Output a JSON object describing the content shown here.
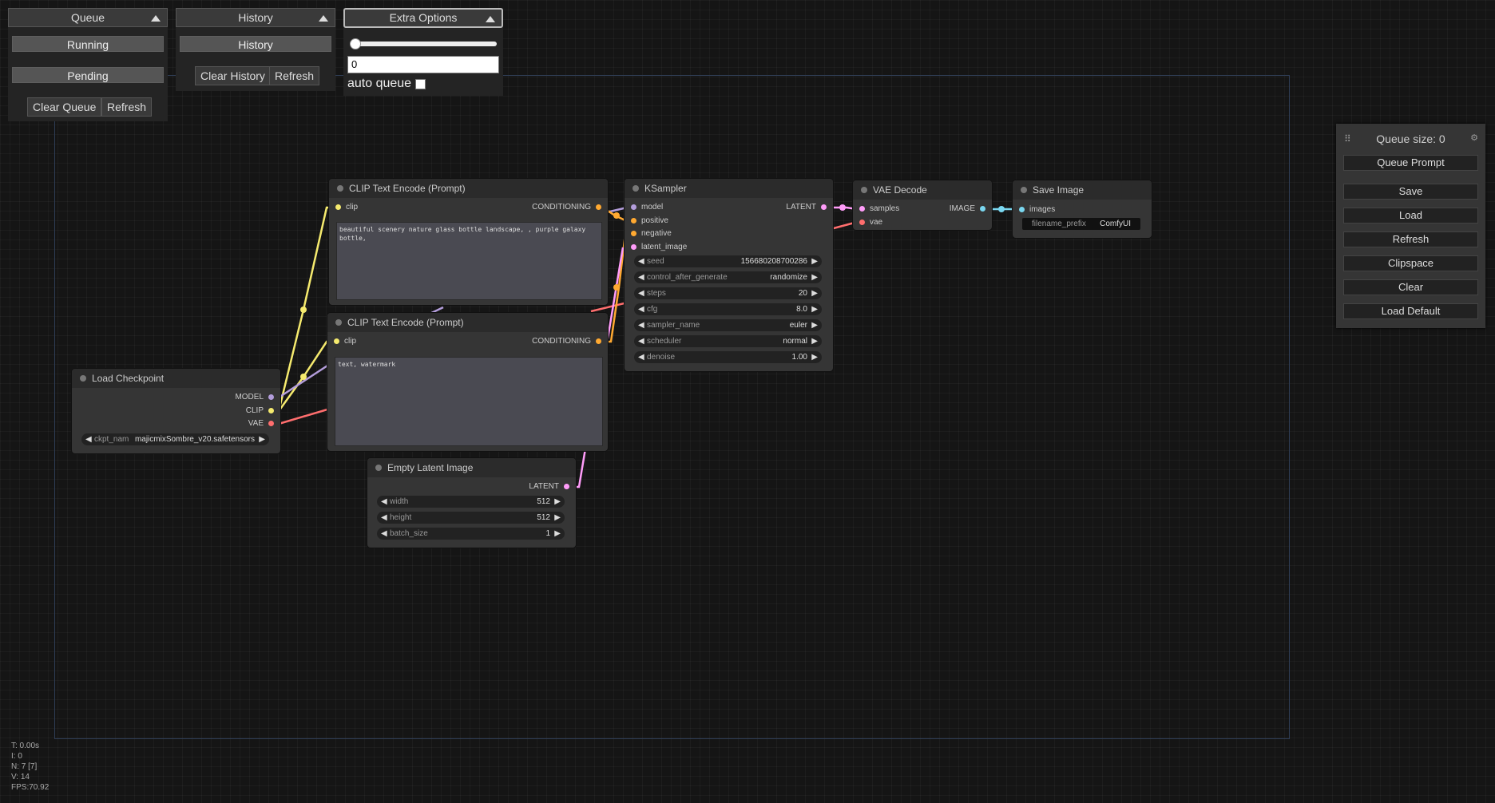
{
  "queue_panel": {
    "title": "Queue",
    "running_label": "Running",
    "pending_label": "Pending",
    "clear_label": "Clear Queue",
    "refresh_label": "Refresh"
  },
  "history_panel": {
    "title": "History",
    "history_label": "History",
    "clear_label": "Clear History",
    "refresh_label": "Refresh"
  },
  "extra_panel": {
    "title": "Extra Options",
    "slider_value": 0,
    "batch_value": "0",
    "auto_queue_label": "auto queue"
  },
  "nodes": {
    "clip1": {
      "title": "CLIP Text Encode (Prompt)",
      "in_clip": "clip",
      "out_cond": "CONDITIONING",
      "text": "beautiful scenery nature glass bottle landscape, , purple galaxy bottle,"
    },
    "clip2": {
      "title": "CLIP Text Encode (Prompt)",
      "in_clip": "clip",
      "out_cond": "CONDITIONING",
      "text": "text, watermark"
    },
    "ksampler": {
      "title": "KSampler",
      "in_model": "model",
      "in_positive": "positive",
      "in_negative": "negative",
      "in_latent": "latent_image",
      "out_latent": "LATENT",
      "widgets": [
        {
          "label": "seed",
          "value": "156680208700286"
        },
        {
          "label": "control_after_generate",
          "value": "randomize"
        },
        {
          "label": "steps",
          "value": "20"
        },
        {
          "label": "cfg",
          "value": "8.0"
        },
        {
          "label": "sampler_name",
          "value": "euler"
        },
        {
          "label": "scheduler",
          "value": "normal"
        },
        {
          "label": "denoise",
          "value": "1.00"
        }
      ]
    },
    "vae_decode": {
      "title": "VAE Decode",
      "in_samples": "samples",
      "in_vae": "vae",
      "out_image": "IMAGE"
    },
    "save_image": {
      "title": "Save Image",
      "in_images": "images",
      "prefix_label": "filename_prefix",
      "prefix_value": "ComfyUI"
    },
    "load_checkpoint": {
      "title": "Load Checkpoint",
      "out_model": "MODEL",
      "out_clip": "CLIP",
      "out_vae": "VAE",
      "ckpt_label": "ckpt_nam",
      "ckpt_value": "majicmixSombre_v20.safetensors"
    },
    "empty_latent": {
      "title": "Empty Latent Image",
      "out_latent": "LATENT",
      "widgets": [
        {
          "label": "width",
          "value": "512"
        },
        {
          "label": "height",
          "value": "512"
        },
        {
          "label": "batch_size",
          "value": "1"
        }
      ]
    }
  },
  "menu": {
    "queue_size": "Queue size: 0",
    "queue_prompt": "Queue Prompt",
    "save": "Save",
    "load": "Load",
    "refresh": "Refresh",
    "clipspace": "Clipspace",
    "clear": "Clear",
    "load_default": "Load Default"
  },
  "stats": {
    "t": "T: 0.00s",
    "i": "I: 0",
    "n": "N: 7 [7]",
    "v": "V: 14",
    "fps": "FPS:70.92"
  },
  "colors": {
    "clip": "#ffe36b",
    "model": "#b39ddb",
    "vae": "#ff6e6e",
    "conditioning": "#ffa931",
    "latent": "#ff9cf9",
    "image": "#64b5f6"
  }
}
